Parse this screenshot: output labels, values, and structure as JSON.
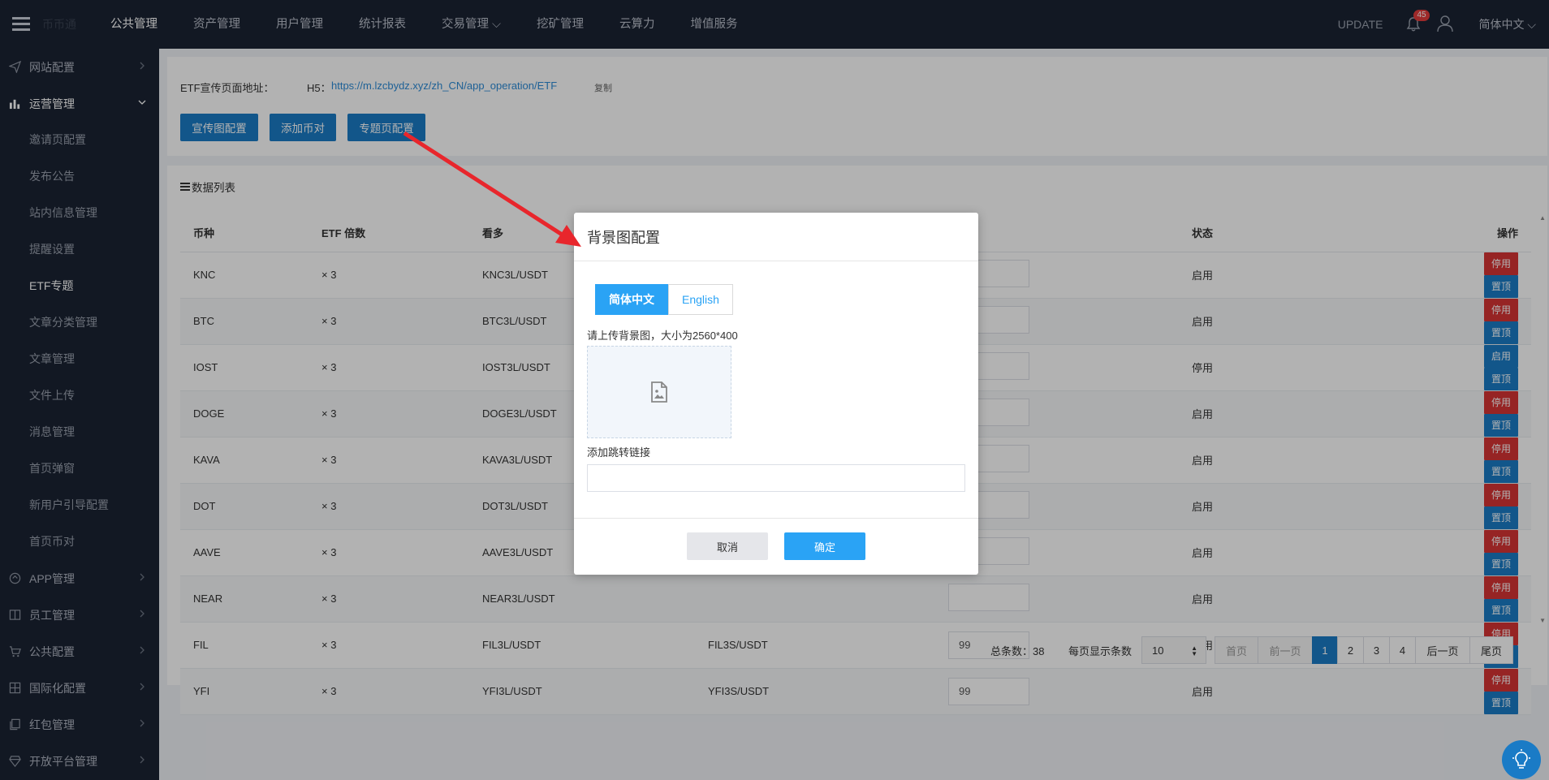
{
  "topnav": {
    "brand": "币币通",
    "items": [
      "公共管理",
      "资产管理",
      "用户管理",
      "统计报表",
      "交易管理",
      "挖矿管理",
      "云算力",
      "增值服务"
    ],
    "update": "UPDATE",
    "badge": "45",
    "lang": "简体中文"
  },
  "sidebar": {
    "items": [
      {
        "label": "网站配置",
        "icon": "send-icon"
      },
      {
        "label": "运营管理",
        "icon": "bar-chart-icon"
      },
      {
        "label": "APP管理",
        "icon": "app-icon"
      },
      {
        "label": "员工管理",
        "icon": "book-icon"
      },
      {
        "label": "公共配置",
        "icon": "cart-icon"
      },
      {
        "label": "国际化配置",
        "icon": "grid-icon"
      },
      {
        "label": "红包管理",
        "icon": "copy-icon"
      },
      {
        "label": "开放平台管理",
        "icon": "diamond-icon"
      }
    ],
    "sub": [
      "邀请页配置",
      "发布公告",
      "站内信息管理",
      "提醒设置",
      "ETF专题",
      "文章分类管理",
      "文章管理",
      "文件上传",
      "消息管理",
      "首页弹窗",
      "新用户引导配置",
      "首页币对"
    ]
  },
  "etf": {
    "label": "ETF宣传页面地址：",
    "h5": "H5：",
    "url": "https://m.lzcbydz.xyz/zh_CN/app_operation/ETF",
    "copy": "复制"
  },
  "buttons": {
    "banner": "宣传图配置",
    "add_pair": "添加币对",
    "topic": "专题页配置"
  },
  "list": {
    "title": "数据列表",
    "headers": [
      "币种",
      "ETF 倍数",
      "看多",
      "",
      "",
      "状态",
      "操作"
    ],
    "rows": [
      {
        "coin": "KNC",
        "mult": "× 3",
        "long": "KNC3L/USDT",
        "short": "",
        "hold": "",
        "status": "启用",
        "b1": "停用",
        "b2": "置顶"
      },
      {
        "coin": "BTC",
        "mult": "× 3",
        "long": "BTC3L/USDT",
        "short": "",
        "hold": "",
        "status": "启用",
        "b1": "停用",
        "b2": "置顶"
      },
      {
        "coin": "IOST",
        "mult": "× 3",
        "long": "IOST3L/USDT",
        "short": "",
        "hold": "",
        "status": "停用",
        "b1": "启用",
        "b2": "置顶"
      },
      {
        "coin": "DOGE",
        "mult": "× 3",
        "long": "DOGE3L/USDT",
        "short": "",
        "hold": "",
        "status": "启用",
        "b1": "停用",
        "b2": "置顶"
      },
      {
        "coin": "KAVA",
        "mult": "× 3",
        "long": "KAVA3L/USDT",
        "short": "",
        "hold": "",
        "status": "启用",
        "b1": "停用",
        "b2": "置顶"
      },
      {
        "coin": "DOT",
        "mult": "× 3",
        "long": "DOT3L/USDT",
        "short": "",
        "hold": "",
        "status": "启用",
        "b1": "停用",
        "b2": "置顶"
      },
      {
        "coin": "AAVE",
        "mult": "× 3",
        "long": "AAVE3L/USDT",
        "short": "",
        "hold": "",
        "status": "启用",
        "b1": "停用",
        "b2": "置顶"
      },
      {
        "coin": "NEAR",
        "mult": "× 3",
        "long": "NEAR3L/USDT",
        "short": "",
        "hold": "",
        "status": "启用",
        "b1": "停用",
        "b2": "置顶"
      },
      {
        "coin": "FIL",
        "mult": "× 3",
        "long": "FIL3L/USDT",
        "short": "FIL3S/USDT",
        "hold": "99",
        "status": "启用",
        "b1": "停用",
        "b2": "置顶"
      },
      {
        "coin": "YFI",
        "mult": "× 3",
        "long": "YFI3L/USDT",
        "short": "YFI3S/USDT",
        "hold": "99",
        "status": "启用",
        "b1": "停用",
        "b2": "置顶"
      }
    ]
  },
  "pager": {
    "total": "总条数：38",
    "perpage": "每页显示条数",
    "size": "10",
    "first": "首页",
    "prev": "前一页",
    "pages": [
      "1",
      "2",
      "3",
      "4"
    ],
    "next": "后一页",
    "last": "尾页"
  },
  "modal": {
    "title": "背景图配置",
    "tab_zh": "简体中文",
    "tab_en": "English",
    "upload_hint": "请上传背景图，大小为2560*400",
    "link_label": "添加跳转链接",
    "link_value": "",
    "cancel": "取消",
    "ok": "确定"
  },
  "colors": {
    "nav_bg": "#1b2333",
    "primary": "#1a7bc6",
    "danger": "#d73434",
    "modal_accent": "#2aa3f5",
    "annotation": "#e8262c"
  }
}
